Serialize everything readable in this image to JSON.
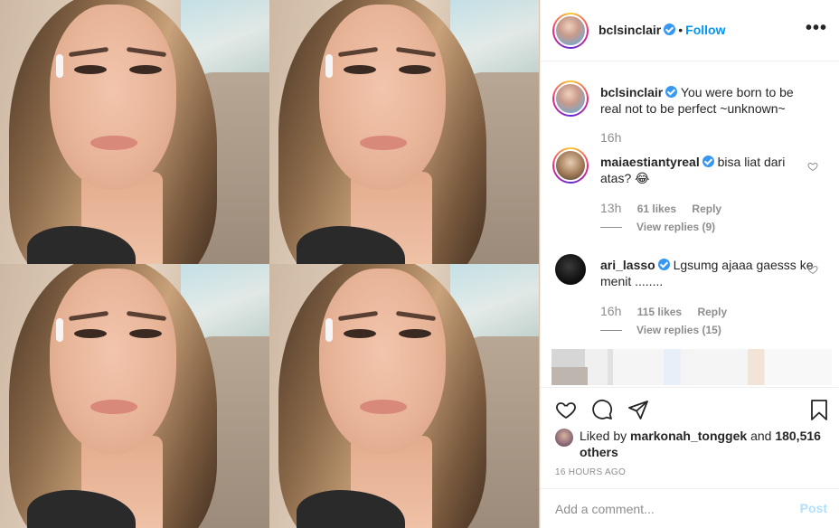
{
  "post": {
    "author": "bclsinclair",
    "follow_label": "Follow",
    "separator": "•",
    "more_label": "•••",
    "caption_author": "bclsinclair",
    "caption_text": "You were born to be real not to be perfect ~unknown~",
    "caption_time": "16h"
  },
  "comments": [
    {
      "username": "maiaestiantyreal",
      "text": "bisa liat dari atas? 😂",
      "time": "13h",
      "likes": "61 likes",
      "reply": "Reply",
      "view_replies": "View replies (9)"
    },
    {
      "username": "ari_lasso",
      "text": "Lgsumg ajaaa gaesss ke menit ........",
      "time": "16h",
      "likes": "115 likes",
      "reply": "Reply",
      "view_replies": "View replies (15)"
    }
  ],
  "likes": {
    "prefix": "Liked by",
    "user": "markonah_tonggek",
    "and": "and",
    "others": "180,516 others"
  },
  "timestamp": "16 HOURS AGO",
  "add_comment": {
    "placeholder": "Add a comment...",
    "post_label": "Post"
  },
  "icons": {
    "like": "heart-icon",
    "comment": "comment-icon",
    "share": "share-icon",
    "save": "bookmark-icon",
    "more": "more-icon",
    "verified": "verified-icon"
  },
  "colors": {
    "accent": "#0095f6",
    "verified": "#3897f0",
    "muted": "#8e8e8e",
    "post_disabled": "#b2dffc"
  }
}
